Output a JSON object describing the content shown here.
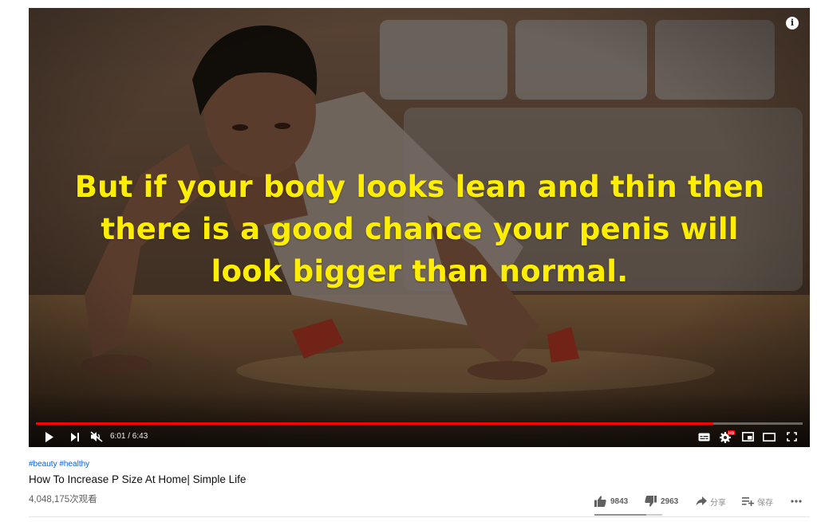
{
  "player": {
    "caption_lines": [
      "But if your body looks lean and thin then",
      "there is a good chance your penis will",
      "look bigger than normal."
    ],
    "info_icon": "info-icon",
    "time_display": "6:01 / 6:43",
    "progress_fraction": 0.8835,
    "hd_badge": "HD",
    "controls": [
      "play-icon",
      "next-icon",
      "volume-muted-icon",
      "subtitles-icon",
      "settings-icon",
      "miniplayer-icon",
      "theater-mode-icon",
      "fullscreen-icon"
    ],
    "colors": {
      "caption": "#ffee00",
      "progress": "#ff0000",
      "hd_badge": "#ff0000"
    }
  },
  "video": {
    "hashtags": [
      "#beauty",
      "#healthy"
    ],
    "title": "How To Increase P Size At Home| Simple Life",
    "views": "4,048,175次观看"
  },
  "actions": {
    "like_count": "9843",
    "dislike_count": "2963",
    "share_label": "分享",
    "save_label": "保存",
    "more_icon": "more-horiz-icon",
    "like_fraction": 0.7686
  }
}
